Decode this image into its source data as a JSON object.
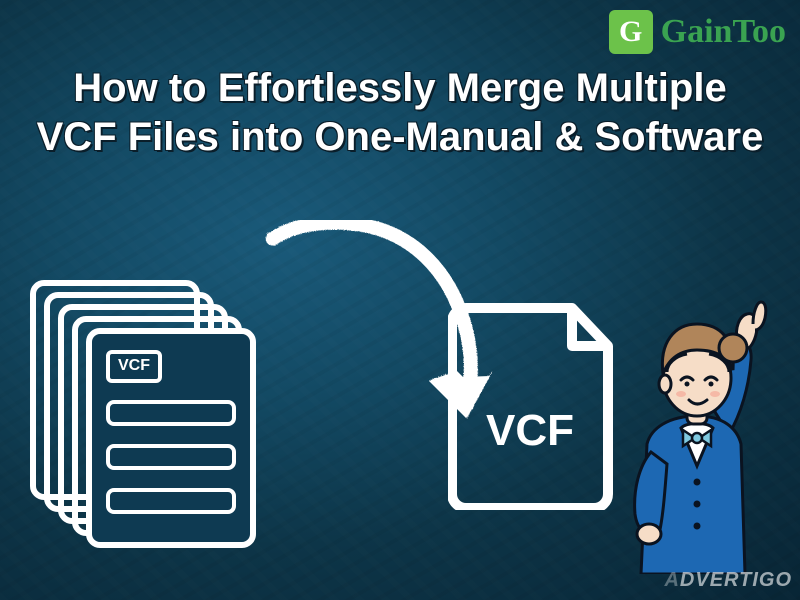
{
  "brand": {
    "badge_letter": "G",
    "name_visible": "GainToo"
  },
  "title": "How to Effortlessly Merge Multiple VCF Files into One-Manual & Software",
  "stack": {
    "badge": "VCF"
  },
  "single_file": {
    "label": "VCF"
  },
  "watermark": {
    "faded_prefix": "A",
    "main": "DVERTIGO"
  },
  "colors": {
    "bg_center": "#1a5a7a",
    "bg_outer": "#082535",
    "accent_green": "#6cc24a",
    "ink": "#ffffff",
    "person_uniform": "#1d68b3",
    "person_bow": "#7fc9e0",
    "person_hair": "#b0855a"
  }
}
